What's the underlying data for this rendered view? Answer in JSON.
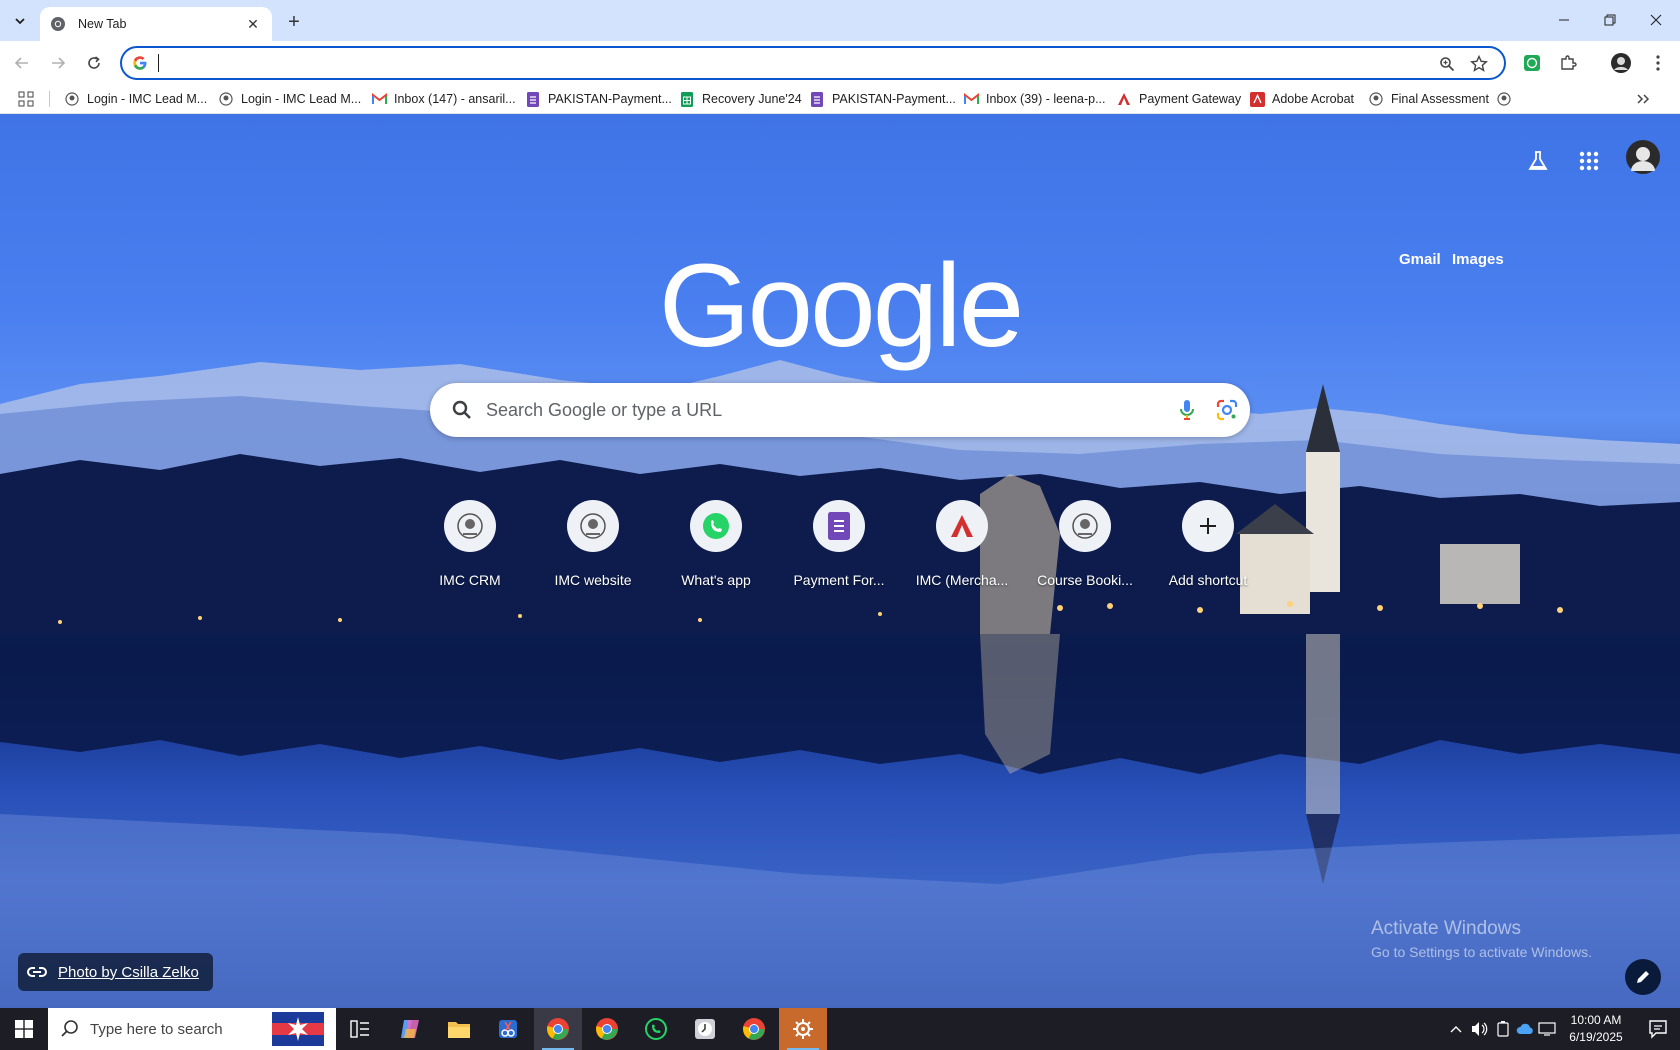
{
  "browser": {
    "tab": {
      "title": "New Tab"
    },
    "omnibox": {
      "value": "",
      "placeholder": ""
    }
  },
  "bookmarks": [
    {
      "label": "Login - IMC Lead M...",
      "icon": "imc-icon"
    },
    {
      "label": "Login - IMC Lead M...",
      "icon": "imc-icon"
    },
    {
      "label": "Inbox (147) - ansaril...",
      "icon": "gmail-icon"
    },
    {
      "label": "PAKISTAN-Payment...",
      "icon": "forms-icon"
    },
    {
      "label": "Recovery June'24",
      "icon": "sheets-icon"
    },
    {
      "label": "PAKISTAN-Payment...",
      "icon": "forms-icon"
    },
    {
      "label": "Inbox (39) - leena-p...",
      "icon": "gmail-icon"
    },
    {
      "label": "Payment Gateway",
      "icon": "acrobat-icon"
    },
    {
      "label": "Adobe Acrobat",
      "icon": "acrobat-icon"
    },
    {
      "label": "Final Assessment",
      "icon": "imc-icon"
    }
  ],
  "ntp": {
    "gmail": "Gmail",
    "images": "Images",
    "logo": "Google",
    "search_placeholder": "Search Google or type a URL",
    "shortcuts": [
      {
        "label": "IMC CRM",
        "icon": "imc-icon"
      },
      {
        "label": "IMC website",
        "icon": "imc-icon"
      },
      {
        "label": "What's app",
        "icon": "whatsapp-icon"
      },
      {
        "label": "Payment For...",
        "icon": "forms-icon"
      },
      {
        "label": "IMC (Mercha...",
        "icon": "acrobat-icon"
      },
      {
        "label": "Course Booki...",
        "icon": "imc-icon"
      },
      {
        "label": "Add shortcut",
        "icon": "plus-icon"
      }
    ],
    "attribution": "Photo by Csilla Zelko",
    "activate_title": "Activate Windows",
    "activate_sub": "Go to Settings to activate Windows."
  },
  "taskbar": {
    "search_placeholder": "Type here to search",
    "time": "10:00 AM",
    "date": "6/19/2025"
  },
  "colors": {
    "accent": "#0b57d0",
    "titlebar": "#d3e3fd",
    "taskbar": "#1d1d26"
  }
}
